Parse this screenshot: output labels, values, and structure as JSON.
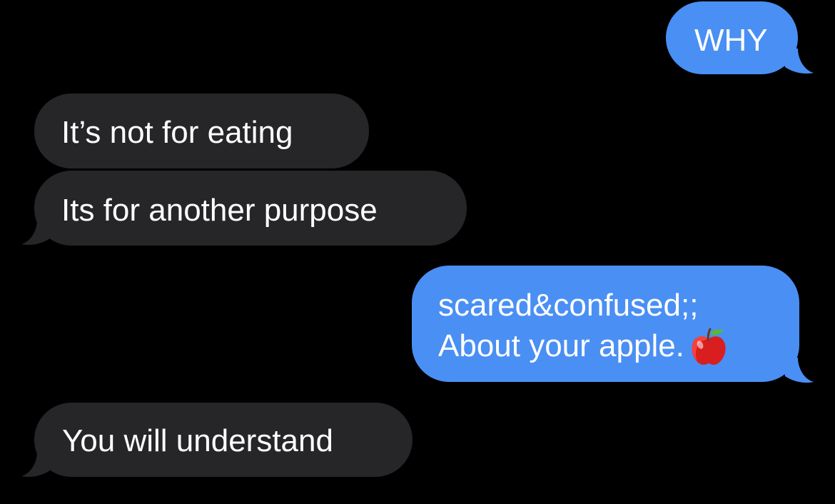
{
  "conversation": {
    "messages": [
      {
        "direction": "outgoing",
        "text": "WHY"
      },
      {
        "direction": "incoming",
        "text": "It’s not for eating"
      },
      {
        "direction": "incoming",
        "text": "Its for another purpose"
      },
      {
        "direction": "outgoing",
        "line1": "scared&confused;;",
        "line2": "About your apple.",
        "emoji": "red-apple"
      },
      {
        "direction": "incoming",
        "text": "You will understand"
      }
    ]
  },
  "colors": {
    "background": "#000000",
    "outgoing_bubble": "#4a8ff3",
    "incoming_bubble": "#262629",
    "text": "#ffffff"
  }
}
